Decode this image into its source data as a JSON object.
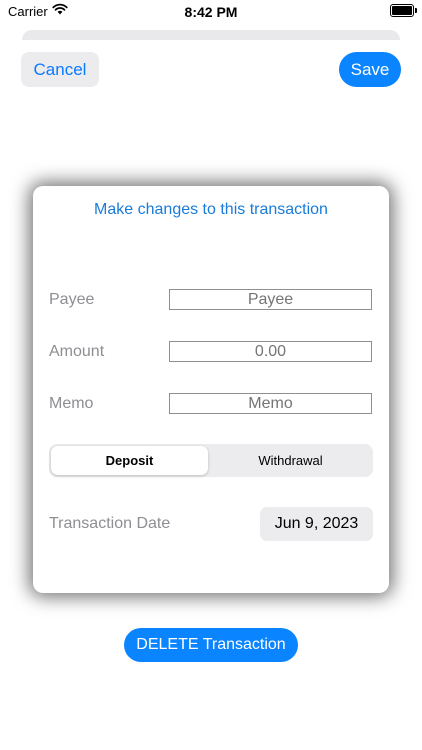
{
  "status_bar": {
    "carrier": "Carrier",
    "time": "8:42 PM"
  },
  "nav": {
    "cancel_label": "Cancel",
    "save_label": "Save"
  },
  "form": {
    "title": "Make changes to this transaction",
    "payee": {
      "label": "Payee",
      "value": "",
      "placeholder": "Payee"
    },
    "amount": {
      "label": "Amount",
      "value": "",
      "placeholder": "0.00"
    },
    "memo": {
      "label": "Memo",
      "value": "",
      "placeholder": "Memo"
    },
    "type_segment": {
      "options": [
        "Deposit",
        "Withdrawal"
      ],
      "selected": "Deposit"
    },
    "date": {
      "label": "Transaction Date",
      "value": "Jun 9, 2023"
    }
  },
  "actions": {
    "delete_label": "DELETE Transaction"
  },
  "colors": {
    "accent": "#0a84ff",
    "title_blue": "#1a7bd9",
    "label_gray": "#8e8e93",
    "control_bg": "#ececee"
  },
  "icons": {
    "wifi": "wifi-icon",
    "battery": "battery-icon"
  }
}
